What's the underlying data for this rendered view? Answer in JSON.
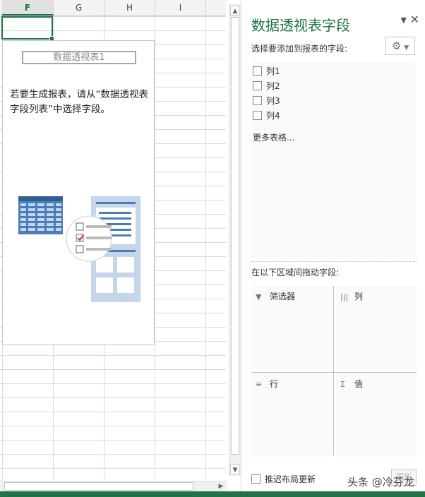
{
  "sheet": {
    "columns": [
      "F",
      "G",
      "H",
      "I"
    ],
    "pivot_title": "数据透视表1",
    "pivot_message": "若要生成报表，请从“数据透视表字段列表”中选择字段。"
  },
  "panel": {
    "title": "数据透视表字段",
    "choose_label": "选择要添加到报表的字段:",
    "fields": [
      "列1",
      "列2",
      "列3",
      "列4"
    ],
    "more_tables": "更多表格...",
    "drag_label": "在以下区域间拖动字段:",
    "areas": {
      "filters": "筛选器",
      "columns": "列",
      "rows": "行",
      "values": "值"
    },
    "defer_label": "推迟布局更新",
    "update_label": "更新"
  },
  "watermark": "头条 @冷芬龙",
  "colors": {
    "accent": "#217346",
    "illustration_blue": "#4a7ebb",
    "illustration_light": "#c4d6ea"
  }
}
